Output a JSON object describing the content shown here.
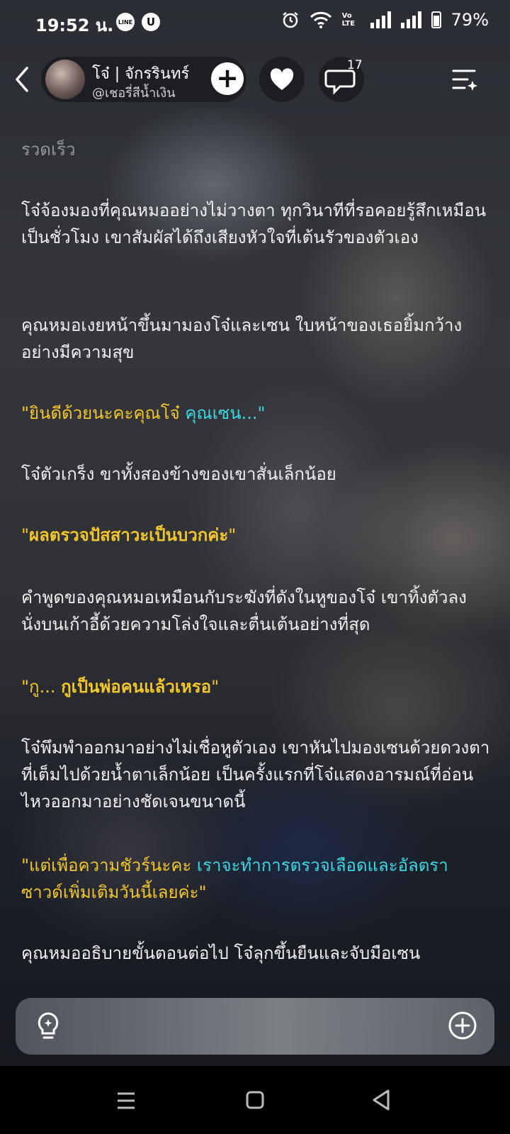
{
  "status_bar": {
    "time": "19:52 น.",
    "line_icon": "LINE",
    "u_icon": "U",
    "volte": "Vo LTE",
    "battery": "79%"
  },
  "header": {
    "author_name": "โจ๋ | จักรรินทร์",
    "author_handle": "@เชอรี่สีน้ำเงิน",
    "comment_count": "17"
  },
  "story": {
    "faded_top": "รวดเร็ว",
    "p1": "โจ๋จ้องมองที่คุณหมออย่างไม่วางตา ทุกวินาทีที่รอคอยรู้สึกเหมือนเป็นชั่วโมง เขาสัมผัสได้ถึงเสียงหัวใจที่เต้นรัวของตัวเอง",
    "p2": "คุณหมอเงยหน้าขึ้นมามองโจ๋และเซน ใบหน้าของเธอยิ้มกว้างอย่างมีความสุข",
    "p3_a": "\"ยินดีด้วยนะคะคุณโจ๋ ",
    "p3_b": "คุณเซน...\"",
    "p4": "โจ๋ตัวเกร็ง ขาทั้งสองข้างของเขาสั่นเล็กน้อย",
    "p5_q1": "\"",
    "p5_b": "ผลตรวจปัสสาวะเป็นบวกค่ะ",
    "p5_q2": "\"",
    "p6": "คำพูดของคุณหมอเหมือนกับระฆังที่ดังในหูของโจ๋ เขาทิ้งตัวลงนั่งบนเก้าอี้ด้วยความโล่งใจและตื่นเต้นอย่างที่สุด",
    "p7_a": "\"กู... ",
    "p7_b": "กูเป็นพ่อคนแล้วเหรอ",
    "p7_c": "\"",
    "p8": "โจ๋พึมพำออกมาอย่างไม่เชื่อหูตัวเอง เขาหันไปมองเซนด้วยดวงตาที่เต็มไปด้วยน้ำตาเล็กน้อย เป็นครั้งแรกที่โจ๋แสดงอารมณ์ที่อ่อนไหวออกมาอย่างชัดเจนขนาดนี้",
    "p9_a": "\"แต่เพื่อความชัวร์นะคะ ",
    "p9_b": "เราจะทำการตรวจเลือดและอัลตรา",
    "p9_c": "ซาวด์เพิ่มเติมวันนี้เลยค่ะ\"",
    "p10": "คุณหมออธิบายขั้นตอนต่อไป โจ๋ลุกขึ้นยืนและจับมือเซน"
  },
  "colors": {
    "quote_yellow": "#f2c62e",
    "quote_cyan": "#3fd6e0"
  }
}
